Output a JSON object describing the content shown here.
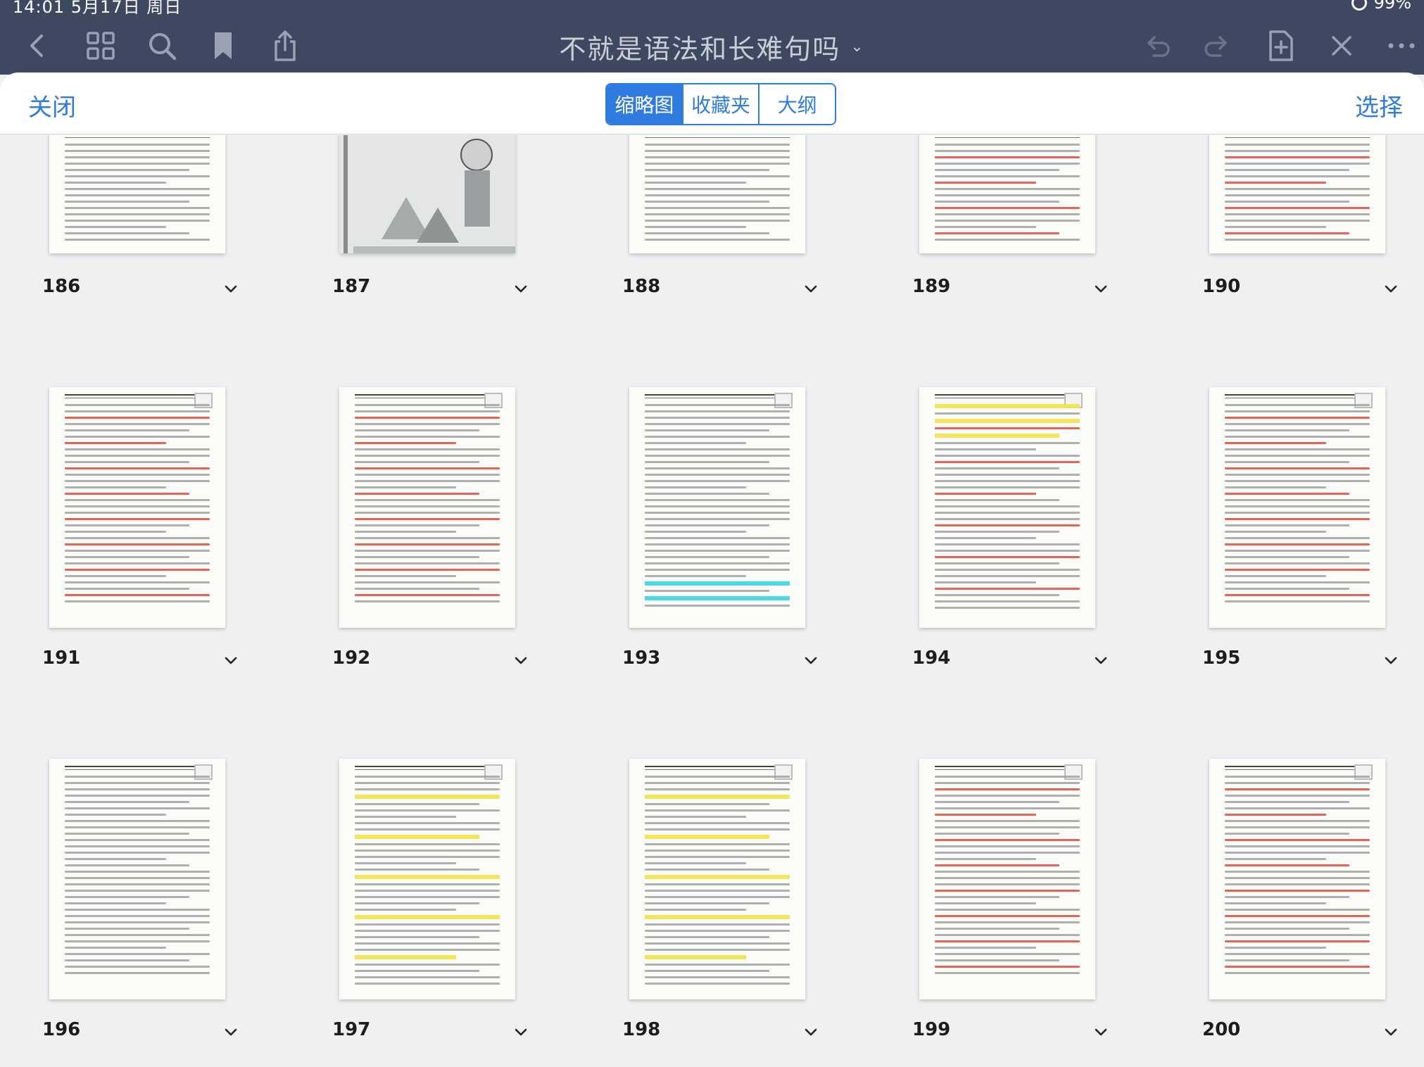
{
  "status_bar": {
    "time": "14:01   5月17日 周日",
    "battery": "99%"
  },
  "toolbar": {
    "title": "不就是语法和长难句吗",
    "title_chevron": "⌄",
    "left_icons": [
      "back-chevron-icon",
      "grid-icon",
      "search-icon",
      "bookmark-icon",
      "share-icon"
    ],
    "right_icons": [
      "undo-icon",
      "redo-icon",
      "add-page-icon",
      "close-x-icon",
      "more-icon"
    ]
  },
  "sheet": {
    "close_label": "关闭",
    "select_label": "选择",
    "segments": [
      {
        "label": "缩略图",
        "active": true
      },
      {
        "label": "收藏夹",
        "active": false
      },
      {
        "label": "大纲",
        "active": false
      }
    ]
  },
  "pages": [
    {
      "number": "186"
    },
    {
      "number": "187"
    },
    {
      "number": "188"
    },
    {
      "number": "189"
    },
    {
      "number": "190"
    },
    {
      "number": "191"
    },
    {
      "number": "192"
    },
    {
      "number": "193"
    },
    {
      "number": "194"
    },
    {
      "number": "195"
    },
    {
      "number": "196"
    },
    {
      "number": "197"
    },
    {
      "number": "198"
    },
    {
      "number": "199"
    },
    {
      "number": "200"
    }
  ],
  "colors": {
    "toolbar_bg": "#3f4861",
    "accent_blue": "#2f7be0",
    "grid_bg": "#eff0f2",
    "highlight_red": "#e0493f",
    "highlight_yellow": "#efe34a",
    "highlight_cyan": "#39d4e0"
  }
}
